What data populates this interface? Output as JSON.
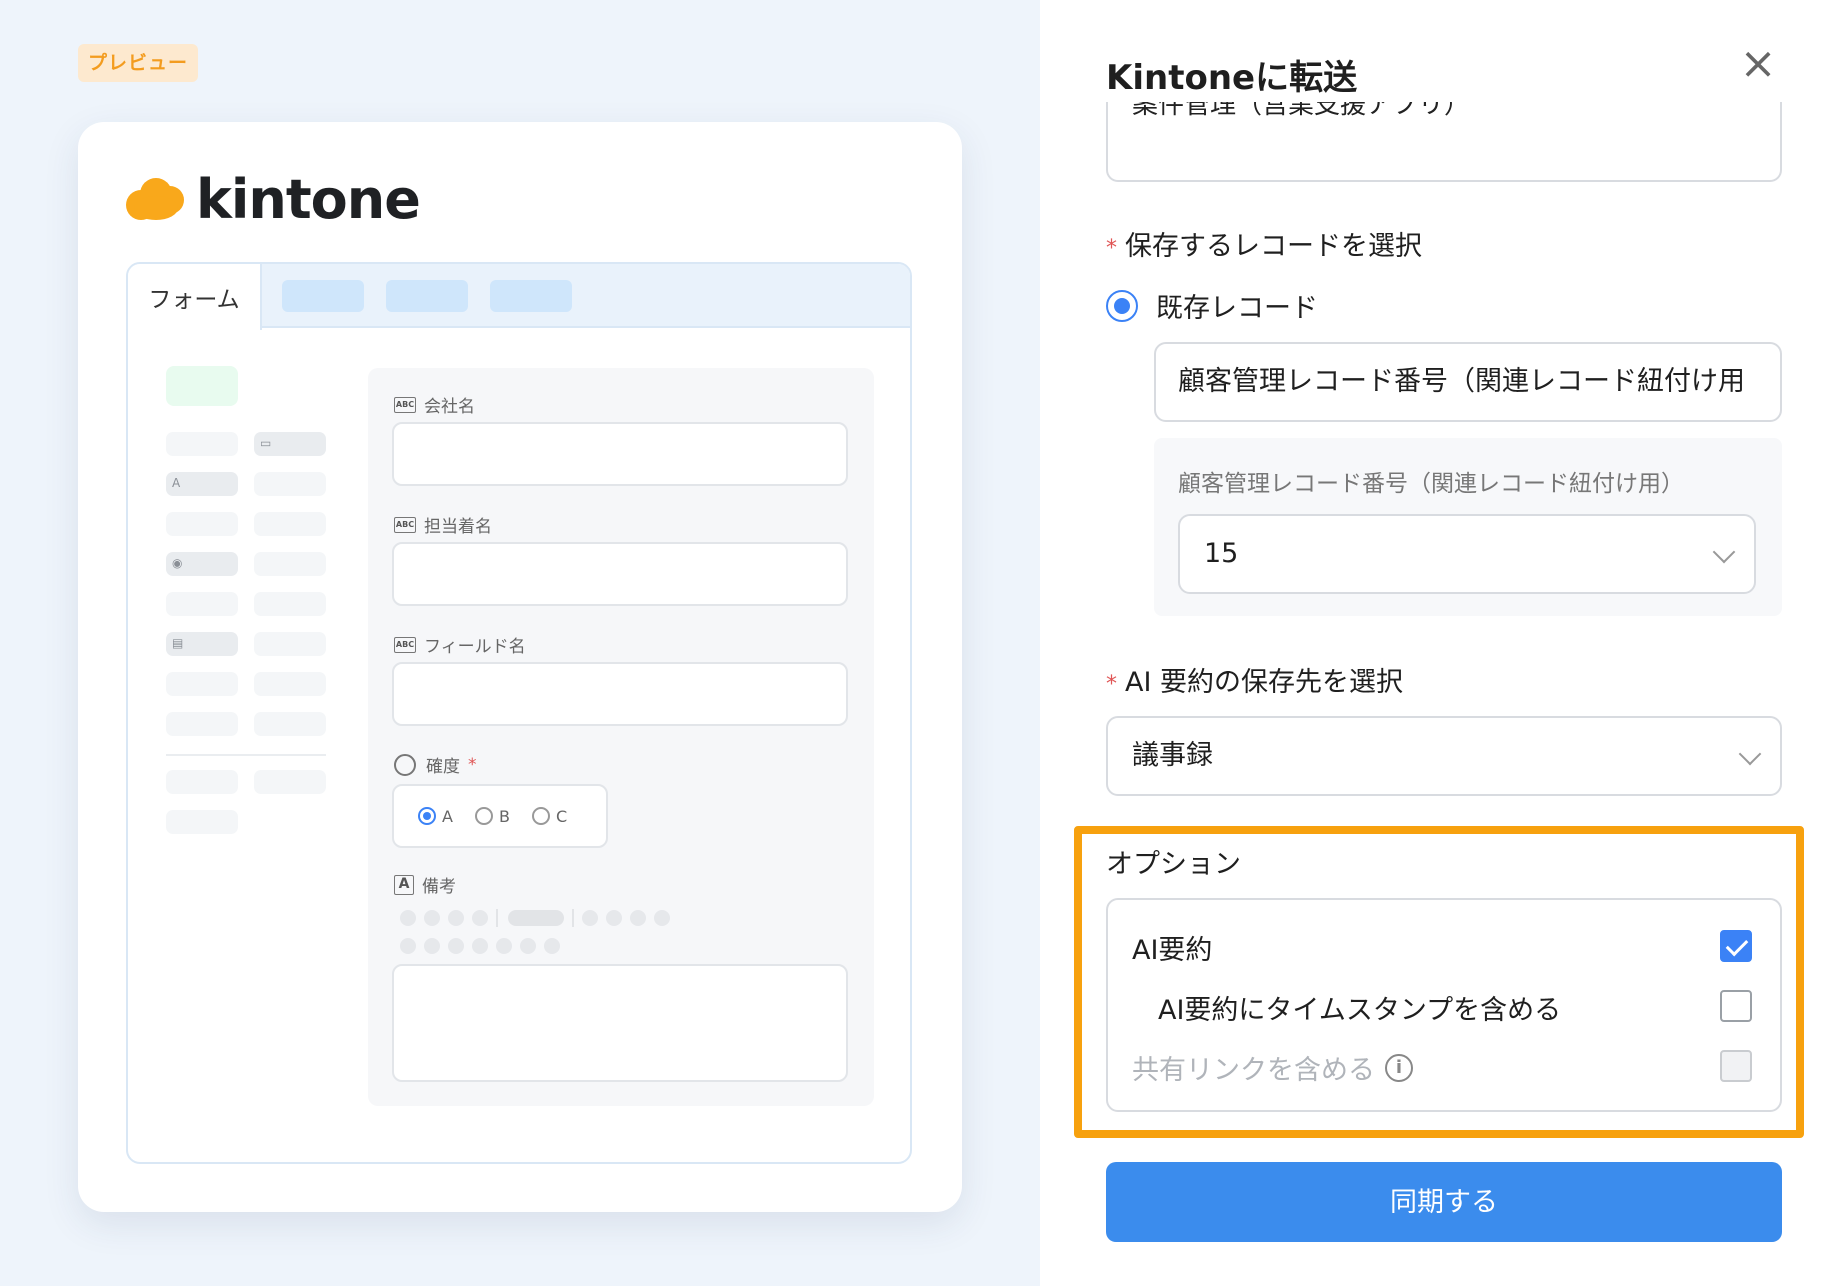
{
  "preview": {
    "badge": "プレビュー",
    "logo_text": "kintone",
    "tab_form": "フォーム",
    "fields": {
      "company": "会社名",
      "person": "担当着名",
      "field_name": "フィールド名",
      "certainty": "確度",
      "certainty_required": "*",
      "options": [
        "A",
        "B",
        "C"
      ],
      "notes": "備考"
    }
  },
  "panel": {
    "title": "Kintoneに転送",
    "close_icon": "close-icon",
    "top_cut_text": "案件管理（営業支援アプリ）",
    "record_section": {
      "required": "*",
      "label": "保存するレコードを選択"
    },
    "existing_record": "既存レコード",
    "record_field_value": "顧客管理レコード番号（関連レコード紐付け用",
    "sub_label": "顧客管理レコード番号（関連レコード紐付け用）",
    "sub_select_value": "15",
    "ai_section": {
      "required": "*",
      "label": "AI 要約の保存先を選択"
    },
    "ai_select_value": "議事録",
    "options_title": "オプション",
    "options": [
      {
        "label": "AI要約",
        "checked": true
      },
      {
        "label": "AI要約にタイムスタンプを含める",
        "checked": false
      },
      {
        "label": "共有リンクを含める",
        "checked": false,
        "disabled": true
      }
    ],
    "sync_button": "同期する"
  },
  "colors": {
    "accent": "#3b82f6",
    "button": "#3b8ced",
    "highlight": "#f7a10e",
    "logo": "#f9a81b",
    "required": "#e05555"
  }
}
